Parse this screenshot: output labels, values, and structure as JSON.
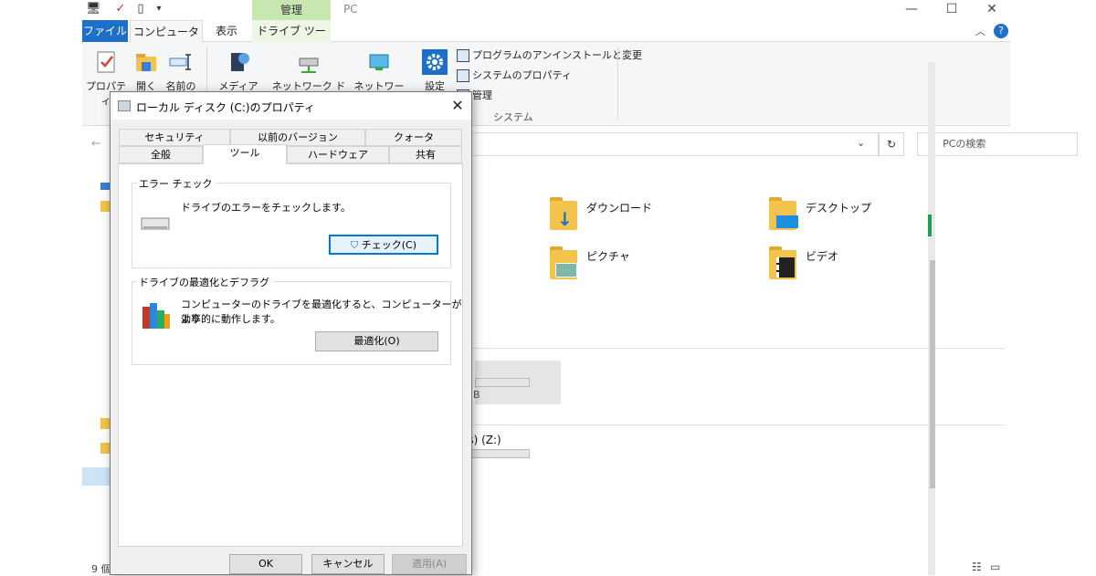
{
  "explorer": {
    "title": "PC",
    "context_tab_header": "管理",
    "tabs": [
      "ファイル",
      "コンピューター",
      "表示",
      "ドライブ ツール"
    ],
    "ribbon": {
      "buttons": [
        "プロパティ",
        "開く",
        "名前の",
        "メディアの",
        "ネットワーク ドライブ",
        "ネットワークの",
        "設定"
      ],
      "small_items": [
        "プログラムのアンインストールと変更",
        "システムのプロパティ",
        "管理"
      ],
      "group_label": "システム"
    },
    "search_placeholder": "PCの検索",
    "folders": [
      "ダウンロード",
      "デスクトップ",
      "ピクチャ",
      "ビデオ"
    ],
    "drive_partial_label": "ers) (Z:)",
    "drive_size_partial": "B",
    "drive_size_partial2": "GB",
    "status_text": "9 個"
  },
  "dialog": {
    "title": "ローカル ディスク (C:)のプロパティ",
    "tabs_row1": [
      "セキュリティ",
      "以前のバージョン",
      "クォータ"
    ],
    "tabs_row2": [
      "全般",
      "ツール",
      "ハードウェア",
      "共有"
    ],
    "error_check": {
      "title": "エラー チェック",
      "description": "ドライブのエラーをチェックします。",
      "button": "チェック(C)"
    },
    "optimize": {
      "title": "ドライブの最適化とデフラグ",
      "description_line1": "コンピューターのドライブを最適化すると、コンピューターがより",
      "description_line2": "効率的に動作します。",
      "button": "最適化(O)"
    },
    "buttons": {
      "ok": "OK",
      "cancel": "キャンセル",
      "apply": "適用(A)"
    }
  },
  "colors": {
    "file_tab": "#1e6fc7",
    "context_tab": "#c8e6b0",
    "accent_focus": "#0078d7",
    "folder": "#f2c34d"
  }
}
